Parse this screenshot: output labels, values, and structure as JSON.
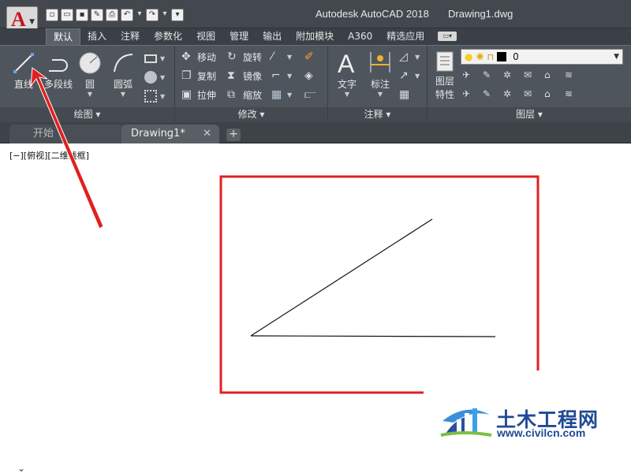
{
  "app": {
    "logo_letter": "A",
    "title": "Autodesk AutoCAD 2018",
    "file": "Drawing1.dwg"
  },
  "ribbon_tabs": [
    "默认",
    "插入",
    "注释",
    "参数化",
    "视图",
    "管理",
    "输出",
    "附加模块",
    "A360",
    "精选应用"
  ],
  "panels": {
    "draw": {
      "title": "绘图 ▾",
      "line": "直线",
      "polyline": "多段线",
      "circle": "圆",
      "arc": "圆弧"
    },
    "modify": {
      "title": "修改 ▾",
      "move": "移动",
      "rotate": "旋转",
      "copy": "复制",
      "mirror": "镜像",
      "stretch": "拉伸",
      "scale": "缩放"
    },
    "annotation": {
      "title": "注释 ▾",
      "text": "文字",
      "dimension": "标注"
    },
    "layers": {
      "title": "图层 ▾",
      "props_line1": "图层",
      "props_line2": "特性",
      "current_layer": "0"
    }
  },
  "doc_tabs": {
    "start": "开始",
    "drawing": "Drawing1*",
    "close": "✕",
    "add": "+"
  },
  "viewport_label": "[−][俯视][二维线框]",
  "watermark": {
    "name": "土木工程网",
    "url": "www.civilcn.com"
  },
  "colors": {
    "highlight_box": "#e02020",
    "annotation_arrow": "#e02020",
    "ribbon_bg": "#4f555c",
    "title_bg": "#43484f"
  }
}
